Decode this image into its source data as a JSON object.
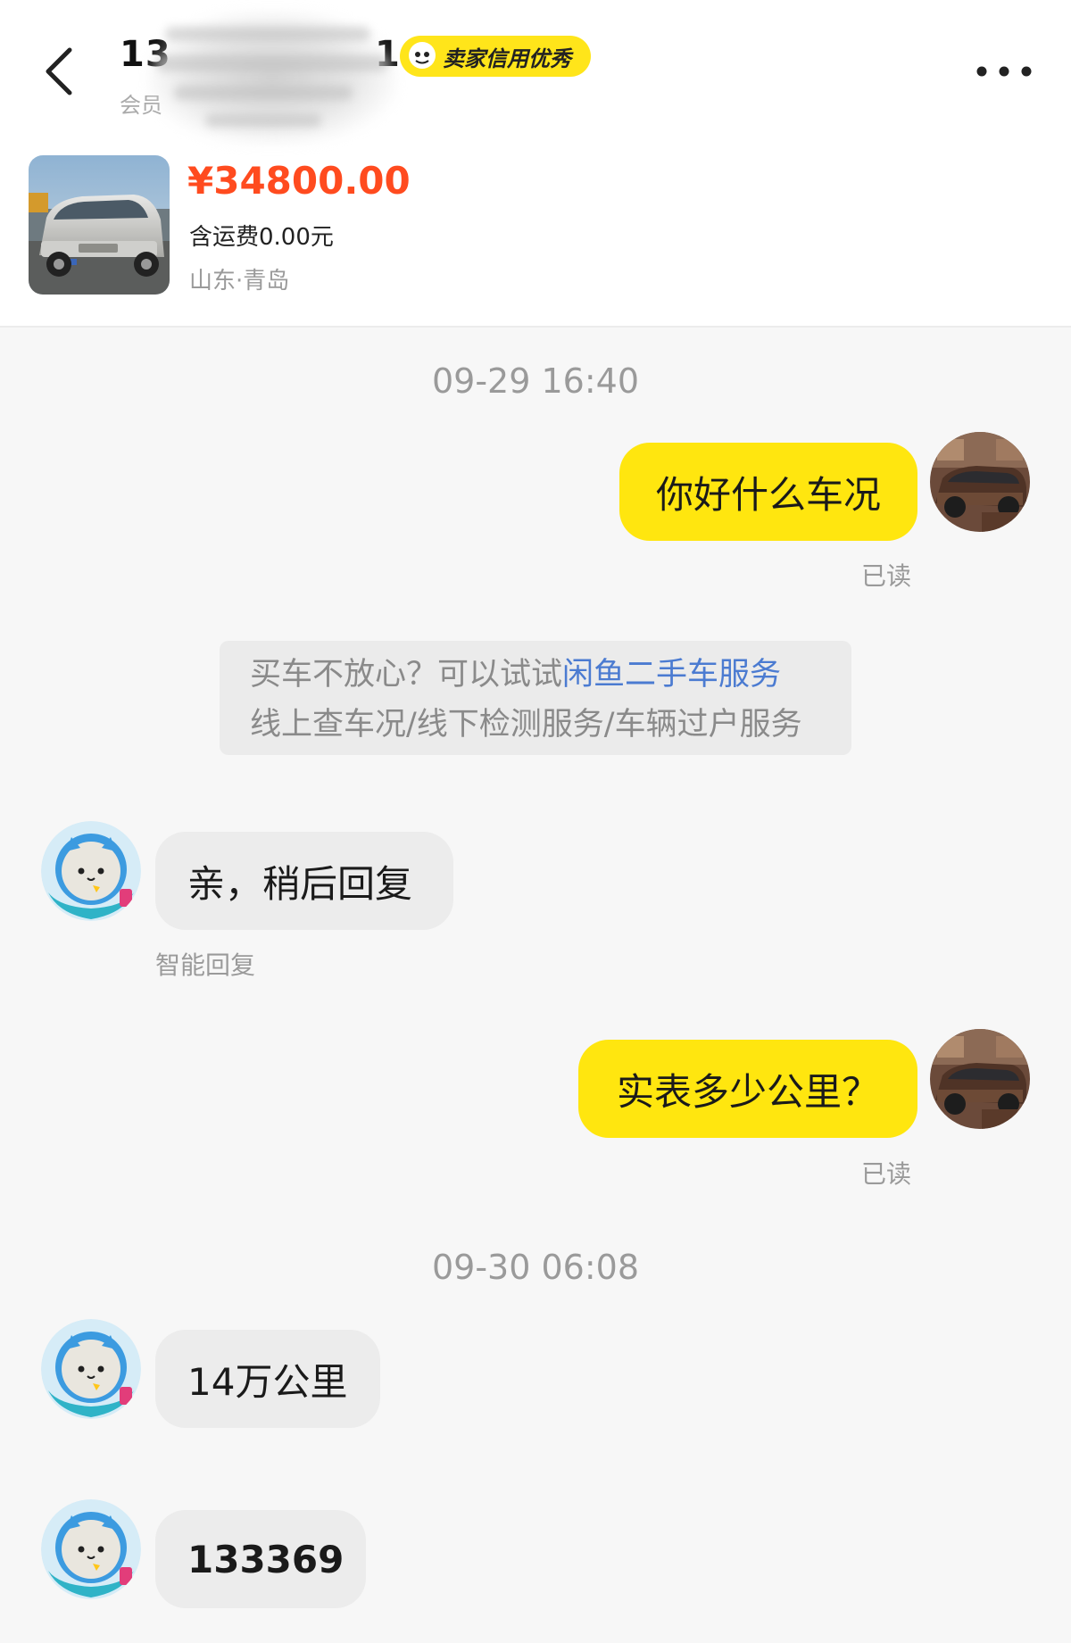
{
  "header": {
    "name_visible": "13",
    "name_suffix_visible": "1",
    "member_label_visible": "会员",
    "badge_label": "卖家信用优秀",
    "icons": {
      "back": "chevron-left-icon",
      "more": "more-dots-icon",
      "badge": "fish-face-icon"
    }
  },
  "product": {
    "price": "¥34800.00",
    "shipping": "含运费0.00元",
    "location": "山东·青岛",
    "image": "silver-minivan-photo"
  },
  "messages": [
    {
      "type": "timestamp",
      "text": "09-29 16:40"
    },
    {
      "type": "outgoing",
      "text": "你好什么车况",
      "status": "已读"
    },
    {
      "type": "system",
      "line1_prefix": "买车不放心？可以试试",
      "line1_link": "闲鱼二手车服务",
      "line2": "线上查车况/线下检测服务/车辆过户服务"
    },
    {
      "type": "incoming",
      "text": "亲，稍后回复",
      "note": "智能回复"
    },
    {
      "type": "outgoing",
      "text": "实表多少公里？",
      "status": "已读"
    },
    {
      "type": "timestamp",
      "text": "09-30 06:08"
    },
    {
      "type": "incoming",
      "text": "14万公里"
    },
    {
      "type": "incoming",
      "text": "133369"
    }
  ],
  "colors": {
    "accent_yellow": "#ffe60f",
    "price_red": "#ff4b1f",
    "link_blue": "#4b7bd1",
    "incoming_bubble": "#ececec",
    "background": "#f7f7f7"
  },
  "avatars": {
    "self": "car-avatar",
    "seller": "cat-astronaut-avatar"
  }
}
